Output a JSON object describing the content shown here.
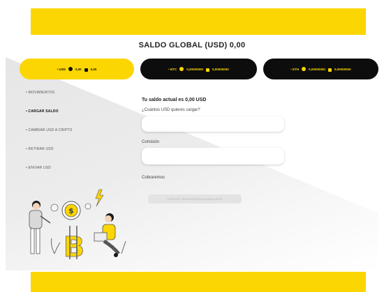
{
  "header": {
    "title": "SALDO GLOBAL (USD) 0,00"
  },
  "wallets": [
    {
      "label": "• USD",
      "amount_1": "0,00",
      "amount_2": "0,00"
    },
    {
      "label": "• BTC",
      "amount_1": "0,00000000",
      "amount_2": "0,00000000"
    },
    {
      "label": "• ETH",
      "amount_1": "0,00000000",
      "amount_2": "0,00000000"
    }
  ],
  "sidebar": {
    "items": [
      {
        "label": "• MOVIMIENTOS"
      },
      {
        "label": "• CARGAR SALDO"
      },
      {
        "label": "• CAMBIAR USD A CRIPTO"
      },
      {
        "label": "• RETIRAR USD"
      },
      {
        "label": "• ENVIAR USD"
      }
    ]
  },
  "form": {
    "heading": "Tu saldo actual es 0,00 USD",
    "amount_label": "¿Cuántos USD quieres cargar?",
    "comision_label": "Comisión",
    "total_label": "Cobraremos",
    "submit_label": "CARGAR TRANSFERENCIA BANCARIA"
  },
  "colors": {
    "accent": "#fcd600",
    "dark": "#0d0d0d"
  },
  "icons": {
    "wallet_coin": "bitcoin-coin-icon",
    "wallet_lock": "lock-icon"
  }
}
